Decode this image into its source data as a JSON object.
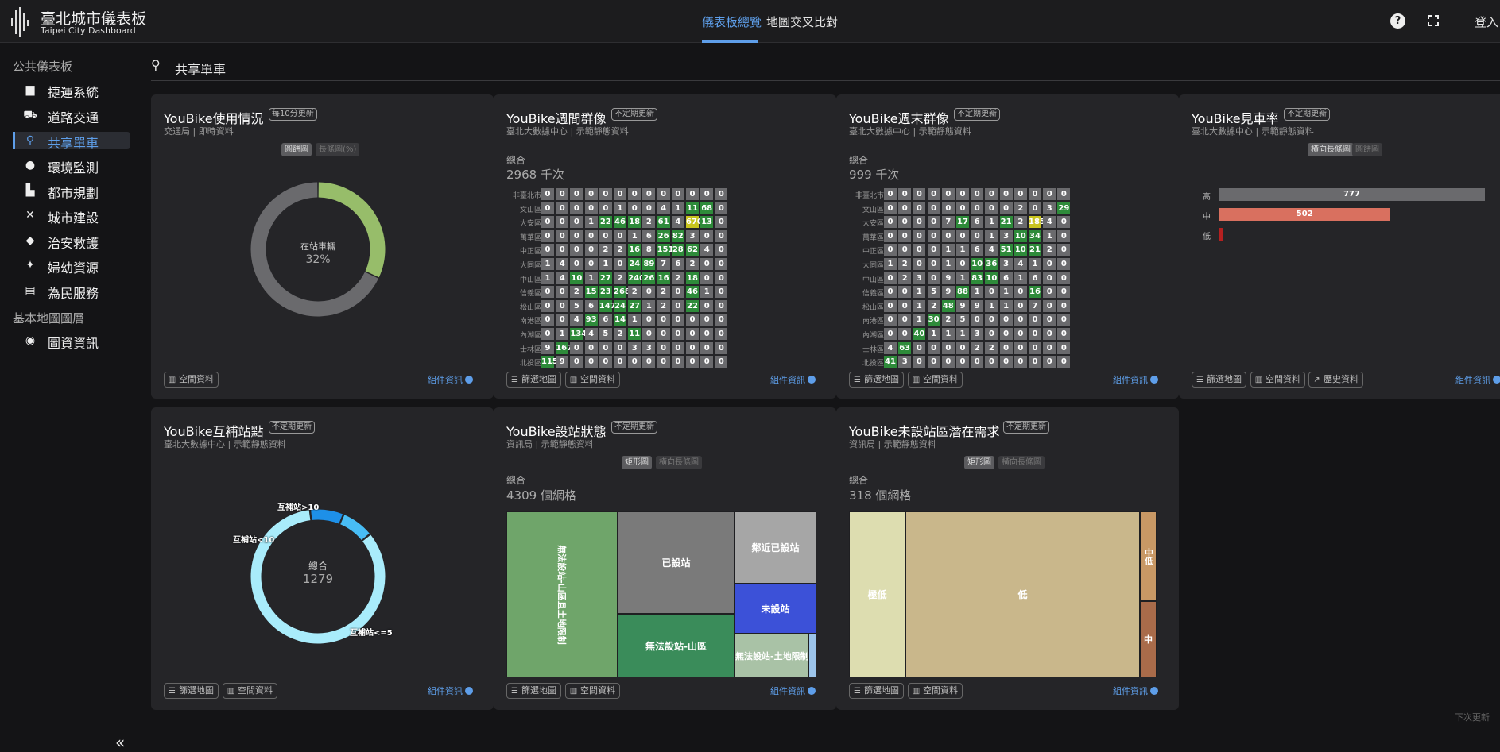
{
  "app": {
    "title": "臺北城市儀表板",
    "subtitle": "Taipei City Dashboard",
    "tabs": [
      "儀表板總覽",
      "地圖交叉比對"
    ],
    "login": "登入"
  },
  "sidebar": {
    "section1": "公共儀表板",
    "items": [
      {
        "icon": "metro-icon",
        "label": "捷運系統"
      },
      {
        "icon": "traffic-icon",
        "label": "道路交通"
      },
      {
        "icon": "bicycle-icon",
        "label": "共享單車"
      },
      {
        "icon": "water-drop-icon",
        "label": "環境監測"
      },
      {
        "icon": "city-planning-icon",
        "label": "都市規劃"
      },
      {
        "icon": "tools-icon",
        "label": "城市建設"
      },
      {
        "icon": "shield-icon",
        "label": "治安救護"
      },
      {
        "icon": "family-icon",
        "label": "婦幼資源"
      },
      {
        "icon": "chat-icon",
        "label": "為民服務"
      }
    ],
    "section2": "基本地圖圖層",
    "items2": [
      {
        "icon": "globe-icon",
        "label": "圖資資訊"
      }
    ],
    "active": "共享單車"
  },
  "page": {
    "title": "共享單車",
    "accent": "#5e9ee9"
  },
  "footer_hint": "下次更新",
  "cards": {
    "usage": {
      "name": "YouBike使用情況",
      "tag": "每10分更新",
      "sub": "交通局 | 即時資料",
      "toggles": [
        "圓餅圖",
        "長條圖(%)"
      ],
      "center_label": "在站車輛",
      "center_value": "32%",
      "buttons": [
        "空間資料"
      ],
      "info": "組件資訊"
    },
    "weekday": {
      "name": "YouBike週間群像",
      "tag": "不定期更新",
      "sub": "臺北大數據中心 | 示範靜態資料",
      "total_label": "總合",
      "total_value": "2968 千次",
      "buttons": [
        "篩選地圖",
        "空間資料"
      ],
      "info": "組件資訊"
    },
    "weekend": {
      "name": "YouBike週末群像",
      "tag": "不定期更新",
      "sub": "臺北大數據中心 | 示範靜態資料",
      "total_label": "總合",
      "total_value": "999 千次",
      "buttons": [
        "篩選地圖",
        "空間資料"
      ],
      "info": "組件資訊"
    },
    "seen": {
      "name": "YouBike見車率",
      "tag": "不定期更新",
      "sub": "臺北大數據中心 | 示範靜態資料",
      "toggles": [
        "橫向長條圖",
        "圓餅圖"
      ],
      "buttons": [
        "篩選地圖",
        "空間資料",
        "歷史資料"
      ],
      "info": "組件資訊"
    },
    "comp": {
      "name": "YouBike互補站點",
      "tag": "不定期更新",
      "sub": "臺北大數據中心 | 示範靜態資料",
      "total_label": "總合",
      "total_value": "1279",
      "buttons": [
        "篩選地圖",
        "空間資料"
      ],
      "info": "組件資訊"
    },
    "status": {
      "name": "YouBike設站狀態",
      "tag": "不定期更新",
      "sub": "資訊局 | 示範靜態資料",
      "toggles": [
        "矩形圖",
        "橫向長條圖"
      ],
      "total_label": "總合",
      "total_value": "4309 個網格",
      "buttons": [
        "篩選地圖",
        "空間資料"
      ],
      "info": "組件資訊"
    },
    "demand": {
      "name": "YouBike未設站區潛在需求",
      "tag": "不定期更新",
      "sub": "資訊局 | 示範靜態資料",
      "toggles": [
        "矩形圖",
        "橫向長條圖"
      ],
      "total_label": "總合",
      "total_value": "318 個網格",
      "buttons": [
        "篩選地圖",
        "空間資料"
      ],
      "info": "組件資訊"
    }
  },
  "chart_data": [
    {
      "id": "usage",
      "type": "pie",
      "values": [
        32,
        68
      ],
      "colors": [
        "#97bd6a",
        "#6a6a6d"
      ],
      "center_label": "在站車輛",
      "center_value": "32%"
    },
    {
      "id": "weekday",
      "type": "heatmap",
      "rows": [
        "非臺北市",
        "文山區",
        "大安區",
        "萬華區",
        "中正區",
        "大同區",
        "中山區",
        "信義區",
        "松山區",
        "南港區",
        "內湖區",
        "士林區",
        "北投區"
      ],
      "values": [
        [
          0,
          0,
          0,
          0,
          0,
          0,
          0,
          0,
          0,
          0,
          0,
          0,
          0
        ],
        [
          0,
          0,
          0,
          0,
          0,
          1,
          0,
          0,
          4,
          1,
          11,
          68,
          0
        ],
        [
          0,
          0,
          0,
          1,
          22,
          46,
          18,
          2,
          61,
          4,
          670,
          13,
          0
        ],
        [
          0,
          0,
          0,
          0,
          0,
          0,
          1,
          6,
          26,
          82,
          3,
          0,
          0
        ],
        [
          0,
          0,
          0,
          0,
          2,
          2,
          16,
          8,
          151,
          28,
          62,
          4,
          0
        ],
        [
          1,
          4,
          0,
          0,
          1,
          0,
          24,
          89,
          7,
          6,
          2,
          0,
          0
        ],
        [
          1,
          4,
          10,
          1,
          27,
          2,
          240,
          26,
          16,
          2,
          18,
          0,
          0
        ],
        [
          0,
          0,
          2,
          15,
          23,
          268,
          2,
          0,
          2,
          0,
          46,
          1,
          0
        ],
        [
          0,
          0,
          5,
          6,
          147,
          24,
          27,
          1,
          2,
          0,
          22,
          0,
          0
        ],
        [
          0,
          0,
          4,
          93,
          6,
          14,
          1,
          0,
          0,
          0,
          0,
          0,
          0
        ],
        [
          0,
          1,
          134,
          4,
          5,
          2,
          11,
          0,
          0,
          0,
          0,
          0,
          0
        ],
        [
          9,
          167,
          0,
          0,
          0,
          0,
          3,
          3,
          0,
          0,
          0,
          0,
          0
        ],
        [
          115,
          9,
          0,
          0,
          0,
          0,
          0,
          0,
          0,
          0,
          0,
          0,
          0
        ]
      ]
    },
    {
      "id": "weekend",
      "type": "heatmap",
      "rows": [
        "非臺北市",
        "文山區",
        "大安區",
        "萬華區",
        "中正區",
        "大同區",
        "中山區",
        "信義區",
        "松山區",
        "南港區",
        "內湖區",
        "士林區",
        "北投區"
      ],
      "values": [
        [
          0,
          0,
          0,
          0,
          0,
          0,
          0,
          0,
          0,
          0,
          0,
          0,
          0
        ],
        [
          0,
          0,
          0,
          0,
          0,
          0,
          0,
          0,
          0,
          2,
          0,
          3,
          29
        ],
        [
          0,
          0,
          0,
          0,
          7,
          17,
          6,
          1,
          21,
          2,
          185,
          4,
          0
        ],
        [
          0,
          0,
          0,
          0,
          0,
          0,
          0,
          1,
          3,
          10,
          34,
          1,
          0
        ],
        [
          0,
          0,
          0,
          0,
          1,
          1,
          6,
          4,
          51,
          10,
          21,
          2,
          0
        ],
        [
          1,
          2,
          0,
          0,
          1,
          0,
          10,
          36,
          3,
          4,
          1,
          0,
          0
        ],
        [
          0,
          2,
          3,
          0,
          9,
          1,
          83,
          10,
          6,
          1,
          6,
          0,
          0
        ],
        [
          0,
          0,
          1,
          5,
          9,
          88,
          1,
          0,
          1,
          0,
          16,
          0,
          0
        ],
        [
          0,
          0,
          1,
          2,
          48,
          9,
          9,
          1,
          1,
          0,
          7,
          0,
          0
        ],
        [
          0,
          0,
          1,
          30,
          2,
          5,
          0,
          0,
          0,
          0,
          0,
          0,
          0
        ],
        [
          0,
          0,
          40,
          1,
          1,
          1,
          3,
          0,
          0,
          0,
          0,
          0,
          0
        ],
        [
          4,
          63,
          0,
          0,
          0,
          0,
          2,
          2,
          0,
          0,
          0,
          0,
          0
        ],
        [
          41,
          3,
          0,
          0,
          0,
          0,
          0,
          0,
          0,
          0,
          0,
          0,
          0
        ]
      ]
    },
    {
      "id": "seen",
      "type": "bar",
      "categories": [
        "高",
        "中",
        "低"
      ],
      "values": [
        777,
        502,
        14
      ],
      "labels": [
        "777",
        "502",
        ""
      ],
      "colors": [
        "#6a6a6d",
        "#d9705f",
        "#b52020"
      ]
    },
    {
      "id": "comp",
      "type": "pie",
      "categories": [
        "互補站>10",
        "互補站<10",
        "互補站<=5"
      ],
      "labels": [
        "互補站>10",
        "互補站<10",
        "互補站<=5"
      ],
      "values": [
        104,
        101,
        1074
      ],
      "colors": [
        "#1e90e8",
        "#48bdf5",
        "#a9ecfb"
      ]
    },
    {
      "id": "status",
      "type": "heatmap",
      "categories": [
        "無法設站-山區且土地限制",
        "已設站",
        "鄰近已設站",
        "未設站",
        "無法設站-山區",
        "無法設站-土地限制",
        ""
      ],
      "labels": [
        "無法設站-山區且土地限制",
        "已設站",
        "鄰近已設站",
        "未設站",
        "無法設站-山區",
        "無法設站-土地限制",
        ""
      ],
      "colors": [
        "#6fa56a",
        "#7a7a7a",
        "#a6a6a6",
        "#3c51d8",
        "#3a8c5a",
        "#a9c2a6",
        "#9cc4ea"
      ]
    },
    {
      "id": "demand",
      "type": "heatmap",
      "categories": [
        "極低",
        "低",
        "中低",
        "中"
      ],
      "labels": [
        "極低",
        "低",
        "中低",
        "中"
      ],
      "colors": [
        "#ddddb0",
        "#c9b78b",
        "#c89865",
        "#a96b4a"
      ]
    }
  ]
}
